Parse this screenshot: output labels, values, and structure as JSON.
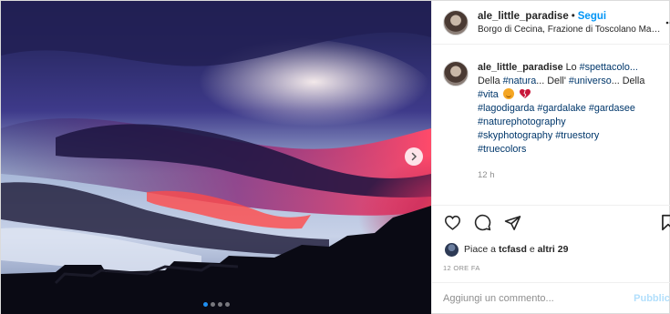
{
  "post": {
    "username": "ale_little_paradise",
    "follow_label": "Segui",
    "location": "Borgo di Cecina, Frazione di Toscolano Mader...",
    "more_icon": "more-horizontal-icon"
  },
  "caption": {
    "username": "ale_little_paradise",
    "text_1": "Lo ",
    "tag_1": "#spettacolo...",
    "text_2": " Della ",
    "tag_2": "#natura",
    "text_3": "... Dell' ",
    "tag_3": "#universo",
    "text_4": "... Della ",
    "tag_4": "#vita",
    "hashtags_line_1": "#lagodigarda #gardalake #gardasee",
    "hashtags_line_2": "#naturephotography",
    "hashtags_line_3": "#skyphotography #truestory",
    "hashtags_line_4": "#truecolors",
    "time": "12 h"
  },
  "actions": {
    "like_icon": "heart-icon",
    "comment_icon": "comment-icon",
    "share_icon": "share-icon",
    "save_icon": "bookmark-icon"
  },
  "likes": {
    "prefix": "Piace a ",
    "user": "tcfasd",
    "joiner": " e ",
    "others": "altri 29"
  },
  "date_label": "12 ORE FA",
  "comment_box": {
    "placeholder": "Aggiungi un commento...",
    "publish_label": "Pubblica"
  },
  "carousel": {
    "total_slides": 4,
    "active_slide": 1
  },
  "colors": {
    "link_blue": "#0095f6",
    "hashtag": "#00376b",
    "muted": "#8e8e8e",
    "publish_disabled": "#b2dffc"
  }
}
